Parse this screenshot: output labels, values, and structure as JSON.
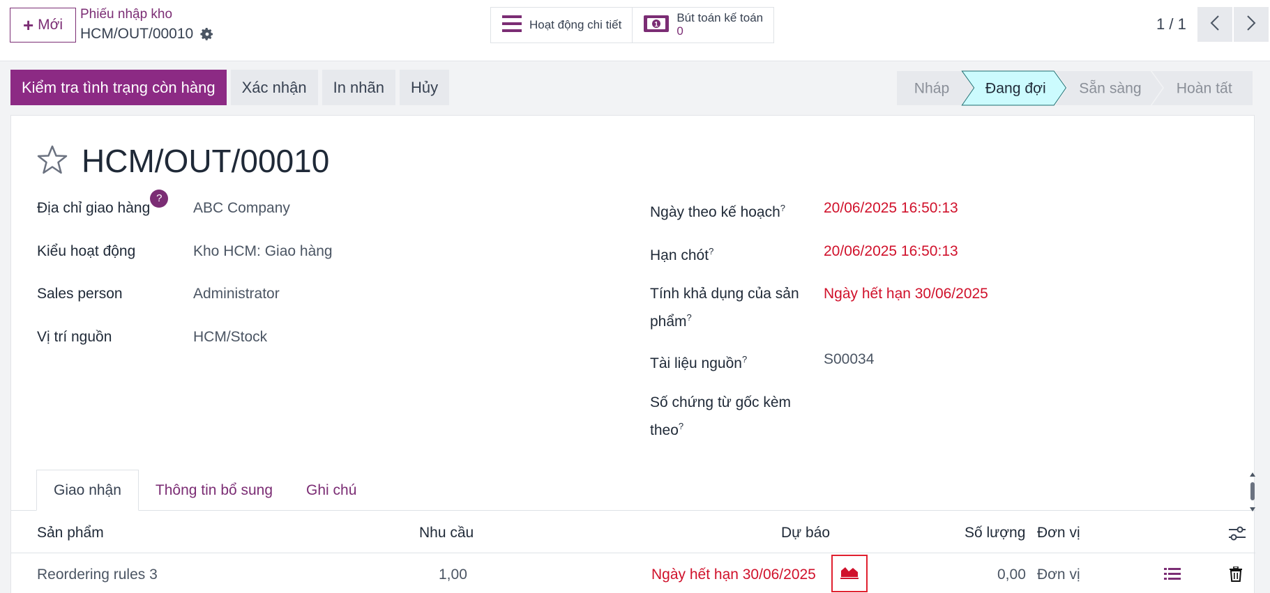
{
  "control_panel": {
    "new_button": "Mới",
    "breadcrumb_parent": "Phiếu nhập kho",
    "breadcrumb_current": "HCM/OUT/00010",
    "smart_buttons": {
      "activity": "Hoạt động chi tiết",
      "journal_label": "Bút toán kế toán",
      "journal_count": "0"
    },
    "pager": "1 / 1"
  },
  "actions": {
    "check_availability": "Kiểm tra tình trạng còn hàng",
    "validate": "Xác nhận",
    "print_labels": "In nhãn",
    "cancel": "Hủy"
  },
  "statusbar": {
    "steps": [
      "Nháp",
      "Đang đợi",
      "Sẵn sàng",
      "Hoàn tất"
    ],
    "active_index": 1
  },
  "record": {
    "title": "HCM/OUT/00010",
    "left_fields": [
      {
        "label": "Địa chỉ giao hàng",
        "value": "ABC Company",
        "help": "?"
      },
      {
        "label": "Kiểu hoạt động",
        "value": "Kho HCM: Giao hàng"
      },
      {
        "label": "Sales person",
        "value": "Administrator"
      },
      {
        "label": "Vị trí nguồn",
        "value": "HCM/Stock"
      }
    ],
    "right_fields": [
      {
        "label": "Ngày theo kế hoạch",
        "value": "20/06/2025 16:50:13",
        "help": "?"
      },
      {
        "label": "Hạn chót",
        "value": "20/06/2025 16:50:13",
        "help": "?"
      },
      {
        "label_line1": "Tính khả dụng của sản",
        "label_line2": "phẩm",
        "value": "Ngày hết hạn 30/06/2025",
        "help": "?"
      },
      {
        "label": "Tài liệu nguồn",
        "value": "S00034",
        "help": "?"
      },
      {
        "label_line1": "Số chứng từ gốc kèm",
        "label_line2": "theo",
        "value": "",
        "help": "?"
      }
    ]
  },
  "tabs": [
    "Giao nhận",
    "Thông tin bổ sung",
    "Ghi chú"
  ],
  "table": {
    "headers": {
      "product": "Sản phẩm",
      "demand": "Nhu cầu",
      "forecast": "Dự báo",
      "quantity": "Số lượng",
      "uom": "Đơn vị"
    },
    "rows": [
      {
        "product": "Reordering rules 3",
        "demand": "1,00",
        "forecast": "Ngày hết hạn 30/06/2025",
        "quantity": "0,00",
        "uom": "Đơn vị"
      }
    ]
  },
  "colors": {
    "brand": "#7b2d74",
    "primary_button": "#8c2a84",
    "danger": "#d0112b",
    "active_step": "#ccfbfe"
  },
  "icons": [
    "plus-icon",
    "gear-icon",
    "list-icon",
    "money-icon",
    "chevron-left-icon",
    "chevron-right-icon",
    "star-icon",
    "help-icon",
    "settings-sliders-icon",
    "forecast-chart-icon",
    "details-list-icon",
    "trash-icon",
    "scrollbar"
  ]
}
